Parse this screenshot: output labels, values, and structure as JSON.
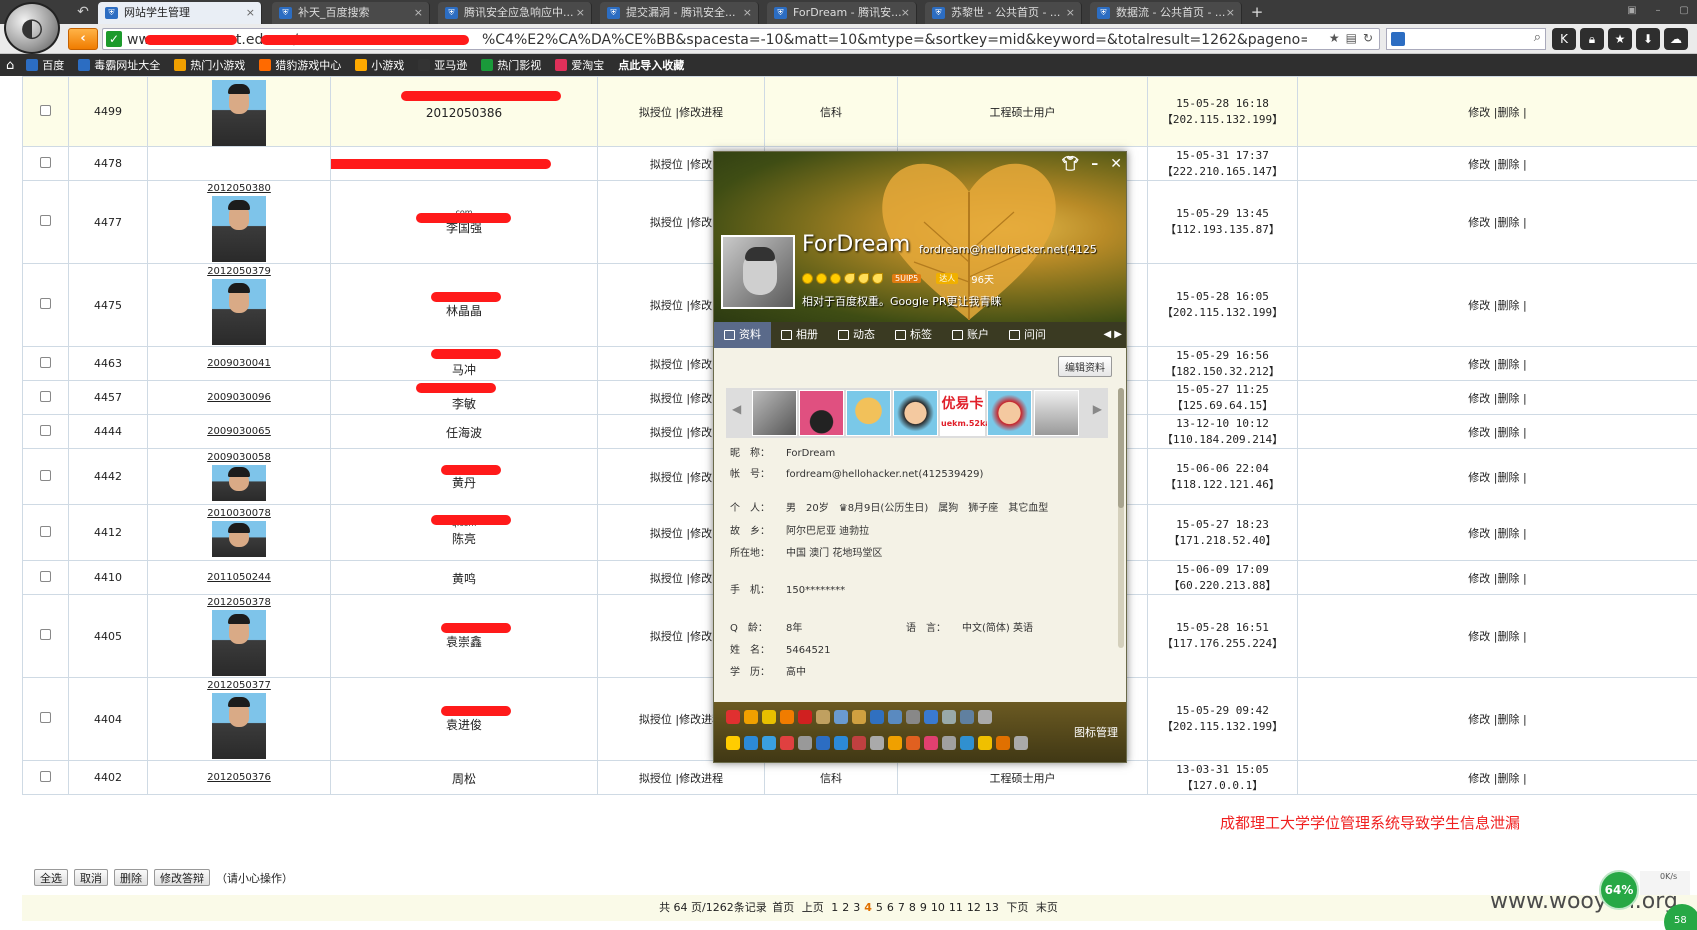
{
  "browser": {
    "tabs": [
      {
        "title": "网站学生管理",
        "active": true
      },
      {
        "title": "补天_百度搜索",
        "active": false
      },
      {
        "title": "腾讯安全应急响应中...",
        "active": false
      },
      {
        "title": "提交漏洞 - 腾讯安全...",
        "active": false
      },
      {
        "title": "ForDream - 腾讯安...",
        "active": false
      },
      {
        "title": "苏黎世 - 公共首页 - ...",
        "active": false
      },
      {
        "title": "数据流 - 公共首页 - ...",
        "active": false
      }
    ],
    "url_prefix": "ww",
    "url_mid1": "t.edu.cn/",
    "url_suffix": "%C4%E2%CA%DA%CE%BB&spacesta=-10&matt=10&mtype=&sortkey=mid&keyword=&totalresult=1262&pageno=4",
    "bookmarks": [
      "百度",
      "毒霸网址大全",
      "热门小游戏",
      "猎豹游戏中心",
      "小游戏",
      "亚马逊",
      "热门影视",
      "爱淘宝",
      "点此导入收藏"
    ]
  },
  "table": {
    "rows": [
      {
        "num": "4499",
        "sid": "",
        "photo": "tall",
        "email": "",
        "name": "2012050386",
        "pos": "拟授位",
        "edit": "|修改进程",
        "subject": "信科",
        "type": "工程硕士用户",
        "date": "15-05-28 16:18",
        "ip": "【202.115.132.199】"
      },
      {
        "num": "4478",
        "sid": "",
        "photo": "none",
        "email": "",
        "name": "",
        "pos": "拟授位",
        "edit": "|修改",
        "subject": "",
        "type": "",
        "date": "15-05-31 17:37",
        "ip": "【222.210.165.147】"
      },
      {
        "num": "4477",
        "sid": "2012050380",
        "photo": "tall",
        "email": "com",
        "name": "李国强",
        "pos": "拟授位",
        "edit": "|修改",
        "subject": "",
        "type": "",
        "date": "15-05-29 13:45",
        "ip": "【112.193.135.87】"
      },
      {
        "num": "4475",
        "sid": "2012050379",
        "photo": "tall",
        "email": "3@qq.com",
        "name": "林晶晶",
        "pos": "拟授位",
        "edit": "|修改",
        "subject": "",
        "type": "",
        "date": "15-05-28 16:05",
        "ip": "【202.115.132.199】"
      },
      {
        "num": "4463",
        "sid": "2009030041",
        "photo": "none",
        "email": "qq.com",
        "name": "马冲",
        "pos": "拟授位",
        "edit": "|修改",
        "subject": "",
        "type": "",
        "date": "15-05-29 16:56",
        "ip": "【182.150.32.212】"
      },
      {
        "num": "4457",
        "sid": "2009030096",
        "photo": "none",
        "email": "1517@qq.com",
        "name": "李敏",
        "pos": "拟授位",
        "edit": "|修改",
        "subject": "",
        "type": "",
        "date": "15-05-27 11:25",
        "ip": "【125.69.64.15】"
      },
      {
        "num": "4444",
        "sid": "2009030065",
        "photo": "none",
        "email": "",
        "name": "任海波",
        "pos": "拟授位",
        "edit": "|修改",
        "subject": "",
        "type": "",
        "date": "13-12-10 10:12",
        "ip": "【110.184.209.214】"
      },
      {
        "num": "4442",
        "sid": "2009030058",
        "photo": "small",
        "email": "qq.com",
        "name": "黄丹",
        "pos": "拟授位",
        "edit": "|修改",
        "subject": "",
        "type": "",
        "date": "15-06-06 22:04",
        "ip": "【118.122.121.46】"
      },
      {
        "num": "4412",
        "sid": "2010030078",
        "photo": "small",
        "email": "q.com",
        "name": "陈亮",
        "pos": "拟授位",
        "edit": "|修改",
        "subject": "",
        "type": "",
        "date": "15-05-27 18:23",
        "ip": "【171.218.52.40】"
      },
      {
        "num": "4410",
        "sid": "2011050244",
        "photo": "none",
        "email": "",
        "name": "黄鸣",
        "pos": "拟授位",
        "edit": "|修改",
        "subject": "",
        "type": "",
        "date": "15-06-09 17:09",
        "ip": "【60.220.213.88】"
      },
      {
        "num": "4405",
        "sid": "2012050378",
        "photo": "tall",
        "email": "com",
        "name": "袁崇鑫",
        "pos": "拟授位",
        "edit": "|修改",
        "subject": "",
        "type": "",
        "date": "15-05-28 16:51",
        "ip": "【117.176.255.224】"
      },
      {
        "num": "4404",
        "sid": "2012050377",
        "photo": "tall",
        "email": "q.com",
        "name": "袁进俊",
        "pos": "拟授位",
        "edit": "|修改进程",
        "subject": "信科",
        "type": "工程硕士用户",
        "date": "15-05-29 09:42",
        "ip": "【202.115.132.199】"
      },
      {
        "num": "4402",
        "sid": "2012050376",
        "photo": "none",
        "email": "",
        "name": "周松",
        "pos": "拟授位",
        "edit": "|修改进程",
        "subject": "信科",
        "type": "工程硕士用户",
        "date": "13-03-31 15:05",
        "ip": "【127.0.0.1】"
      }
    ],
    "op_edit": "修改",
    "op_delete": "|删除",
    "op_sep": "|"
  },
  "actions": {
    "select_all": "全选",
    "cancel": "取消",
    "delete": "删除",
    "change_reply": "修改答辩",
    "caution": "（请小心操作）"
  },
  "pagination": {
    "summary": "共 64 页/1262条记录",
    "first": "首页",
    "prev": "上页",
    "pages": [
      "1",
      "2",
      "3",
      "4",
      "5",
      "6",
      "7",
      "8",
      "9",
      "10",
      "11",
      "12",
      "13"
    ],
    "current": "4",
    "next": "下页",
    "last": "末页"
  },
  "qq": {
    "nickname": "ForDream",
    "account_header": "fordream@hellohacker.net(4125",
    "vip_label": "5UIP5",
    "talent_label": "达人",
    "days": "96天",
    "signature": "相对于百度权重。Google PR更让我青睐",
    "tabs": [
      "资料",
      "相册",
      "动态",
      "标签",
      "账户",
      "问问"
    ],
    "edit_button": "编辑资料",
    "thumb_text": "优易卡",
    "thumb_subtext": "uekm.52ka",
    "fields": {
      "nick_label": "昵　称：",
      "nick": "ForDream",
      "acct_label": "帐　号：",
      "acct": "fordream@hellohacker.net(412539429)",
      "personal_label": "个　人：",
      "personal": "男　20岁　♛8月9日(公历生日)　属狗　狮子座　其它血型",
      "hometown_label": "故　乡：",
      "hometown": "阿尔巴尼亚 迪勃拉",
      "location_label": "所在地：",
      "location": "中国 澳门 花地玛堂区",
      "phone_label": "手　机：",
      "phone": "150********",
      "qage_label": "Q　龄：",
      "qage": "8年",
      "lang_label": "语　言：",
      "lang": "中文(简体) 英语",
      "name_label": "姓　名：",
      "name": "5464521",
      "edu_label": "学　历：",
      "edu": "高中"
    },
    "icon_manager": "图标管理"
  },
  "overlay": {
    "caption": "成都理工大学学位管理系统导致学生信息泄漏",
    "watermark": "www.wooyun.org",
    "badge64": "64%",
    "badge58": "58",
    "netmon": "0K/s"
  },
  "colors": {
    "accent_orange": "#f07c00",
    "caption_red": "#f02020",
    "badge_green": "#27a845"
  }
}
